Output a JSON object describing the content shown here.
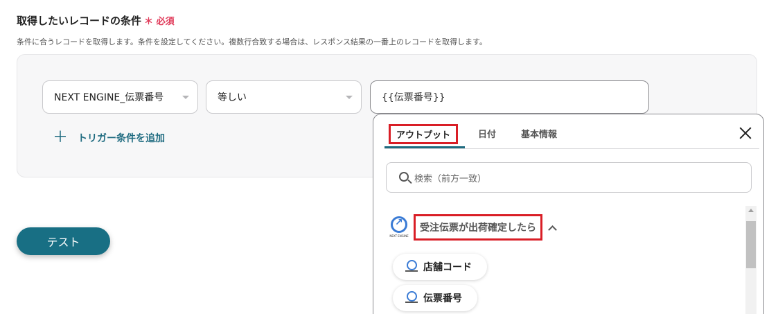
{
  "section": {
    "title": "取得したいレコードの条件",
    "required_mark": "＊",
    "required_label": "必須",
    "description": "条件に合うレコードを取得します。条件を設定してください。複数行合致する場合は、レスポンス結果の一番上のレコードを取得します。"
  },
  "condition": {
    "field_value": "NEXT ENGINE_伝票番号",
    "operator_value": "等しい",
    "value_input": "{{伝票番号}}"
  },
  "add_trigger_label": "トリガー条件を追加",
  "test_button_label": "テスト",
  "popup": {
    "tabs": [
      {
        "label": "アウトプット",
        "active": true
      },
      {
        "label": "日付"
      },
      {
        "label": "基本情報"
      }
    ],
    "search_placeholder": "検索（前方一致）",
    "group": {
      "logo_text": "NEXT ENGINE",
      "title": "受注伝票が出荷確定したら",
      "expanded": true
    },
    "items": [
      {
        "label": "店舗コード"
      },
      {
        "label": "伝票番号"
      }
    ]
  },
  "colors": {
    "accent": "#1f6b80",
    "required": "#e03b5a",
    "highlight": "#d91e26",
    "button": "#186f84"
  }
}
